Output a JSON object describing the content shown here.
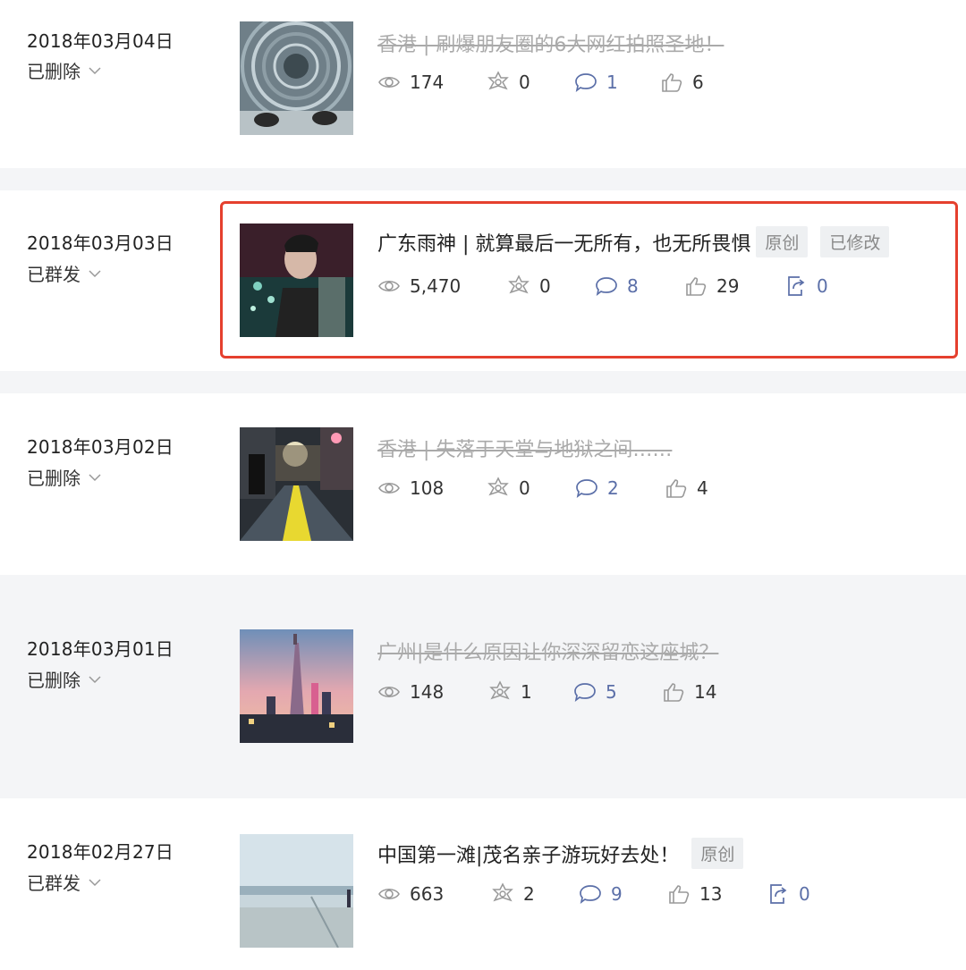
{
  "articles": [
    {
      "date": "2018年03月04日",
      "status": "已删除",
      "title": "香港 | 刷爆朋友圈的6大网红拍照圣地！",
      "views": "174",
      "shares": "0",
      "comments": "1",
      "likes": "6"
    },
    {
      "date": "2018年03月03日",
      "status": "已群发",
      "title": "广东雨神 | 就算最后一无所有，也无所畏惧",
      "tags": [
        "原创",
        "已修改"
      ],
      "views": "5,470",
      "shares": "0",
      "comments": "8",
      "likes": "29",
      "reposts": "0"
    },
    {
      "date": "2018年03月02日",
      "status": "已删除",
      "title": "香港 | 失落于天堂与地狱之间……",
      "views": "108",
      "shares": "0",
      "comments": "2",
      "likes": "4"
    },
    {
      "date": "2018年03月01日",
      "status": "已删除",
      "title": "广州|是什么原因让你深深留恋这座城？",
      "views": "148",
      "shares": "1",
      "comments": "5",
      "likes": "14"
    },
    {
      "date": "2018年02月27日",
      "status": "已群发",
      "title": "中国第一滩|茂名亲子游玩好去处！",
      "tags": [
        "原创"
      ],
      "views": "663",
      "shares": "2",
      "comments": "9",
      "likes": "13",
      "reposts": "0"
    }
  ],
  "icons": {
    "views": "eye-icon",
    "shares": "share-star-icon",
    "comments": "comment-bubble-icon",
    "likes": "thumbs-up-icon",
    "reposts": "repost-icon",
    "status": "chevron-down-icon"
  },
  "colors": {
    "highlight_border": "#e5402e",
    "link_blue": "#5b6fa8",
    "deleted_text": "#aaaaaa"
  }
}
